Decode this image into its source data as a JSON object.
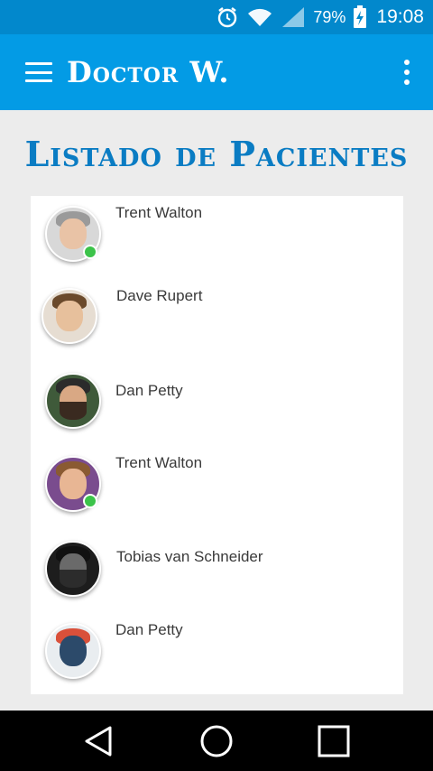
{
  "status_bar": {
    "battery_percent": "79%",
    "time": "19:08",
    "icons": [
      "alarm-icon",
      "wifi-icon",
      "signal-icon",
      "battery-charging-icon"
    ]
  },
  "app_bar": {
    "title": "Doctor W.",
    "icons": [
      "menu-icon",
      "more-vert-icon"
    ]
  },
  "page": {
    "heading": "Listado de Pacientes"
  },
  "patients": [
    {
      "name": "Trent Walton",
      "online": true
    },
    {
      "name": "Dave Rupert",
      "online": false
    },
    {
      "name": "Dan Petty",
      "online": false
    },
    {
      "name": "Trent Walton",
      "online": true
    },
    {
      "name": "Tobias van Schneider",
      "online": false
    },
    {
      "name": "Dan Petty",
      "online": false
    }
  ],
  "nav_bar": {
    "icons": [
      "back-icon",
      "home-icon",
      "recents-icon"
    ]
  },
  "colors": {
    "status_bar": "#0288cc",
    "app_bar": "#039be5",
    "heading": "#0a7cc3",
    "online": "#3cc34a"
  }
}
